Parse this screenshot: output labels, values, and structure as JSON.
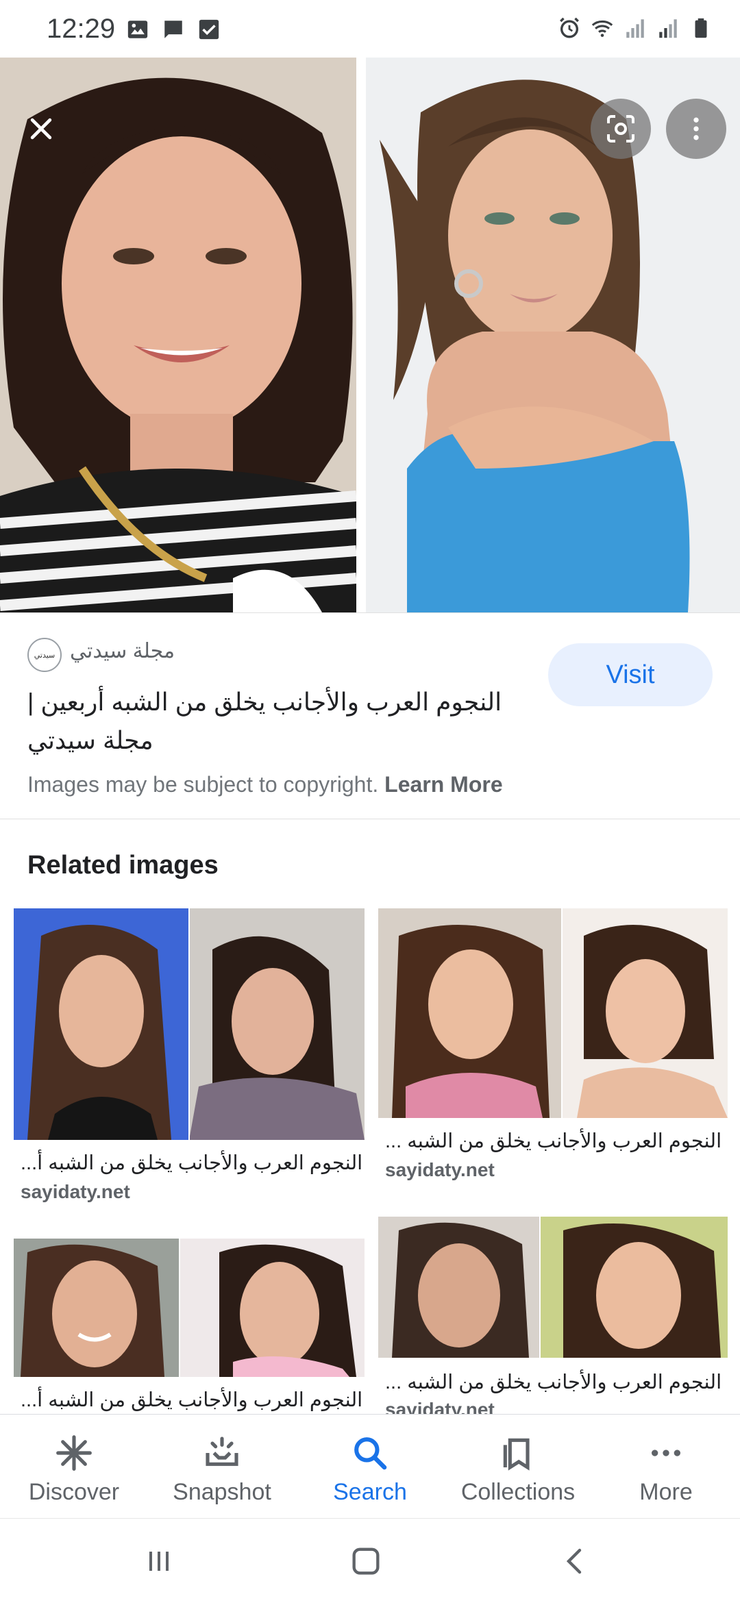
{
  "status_bar": {
    "time": "12:29"
  },
  "source": {
    "name": "مجلة سيدتي",
    "logo_text": "سيدتي",
    "title": "النجوم العرب والأجانب يخلق من الشبه أربعين | مجلة سيدتي",
    "visit_label": "Visit",
    "copyright_text": "Images may be subject to copyright.",
    "learn_more_label": "Learn More"
  },
  "related": {
    "title": "Related images",
    "items": [
      {
        "caption": "النجوم العرب والأجانب يخلق من الشبه أ...",
        "source": "sayidaty.net"
      },
      {
        "caption": "النجوم العرب والأجانب يخلق من الشبه ...",
        "source": "sayidaty.net"
      },
      {
        "caption": "النجوم العرب والأجانب يخلق من الشبه أ...",
        "source": ""
      },
      {
        "caption": "النجوم العرب والأجانب يخلق من الشبه ...",
        "source": "sayidaty.net"
      }
    ]
  },
  "bottom_nav": {
    "items": [
      {
        "label": "Discover",
        "icon": "discover-icon"
      },
      {
        "label": "Snapshot",
        "icon": "snapshot-icon"
      },
      {
        "label": "Search",
        "icon": "search-icon",
        "active": true
      },
      {
        "label": "Collections",
        "icon": "collections-icon"
      },
      {
        "label": "More",
        "icon": "more-icon"
      }
    ]
  },
  "colors": {
    "accent": "#1a73e8",
    "visit_bg": "#e8f0fe",
    "text_primary": "#202124",
    "text_secondary": "#5f6368"
  }
}
